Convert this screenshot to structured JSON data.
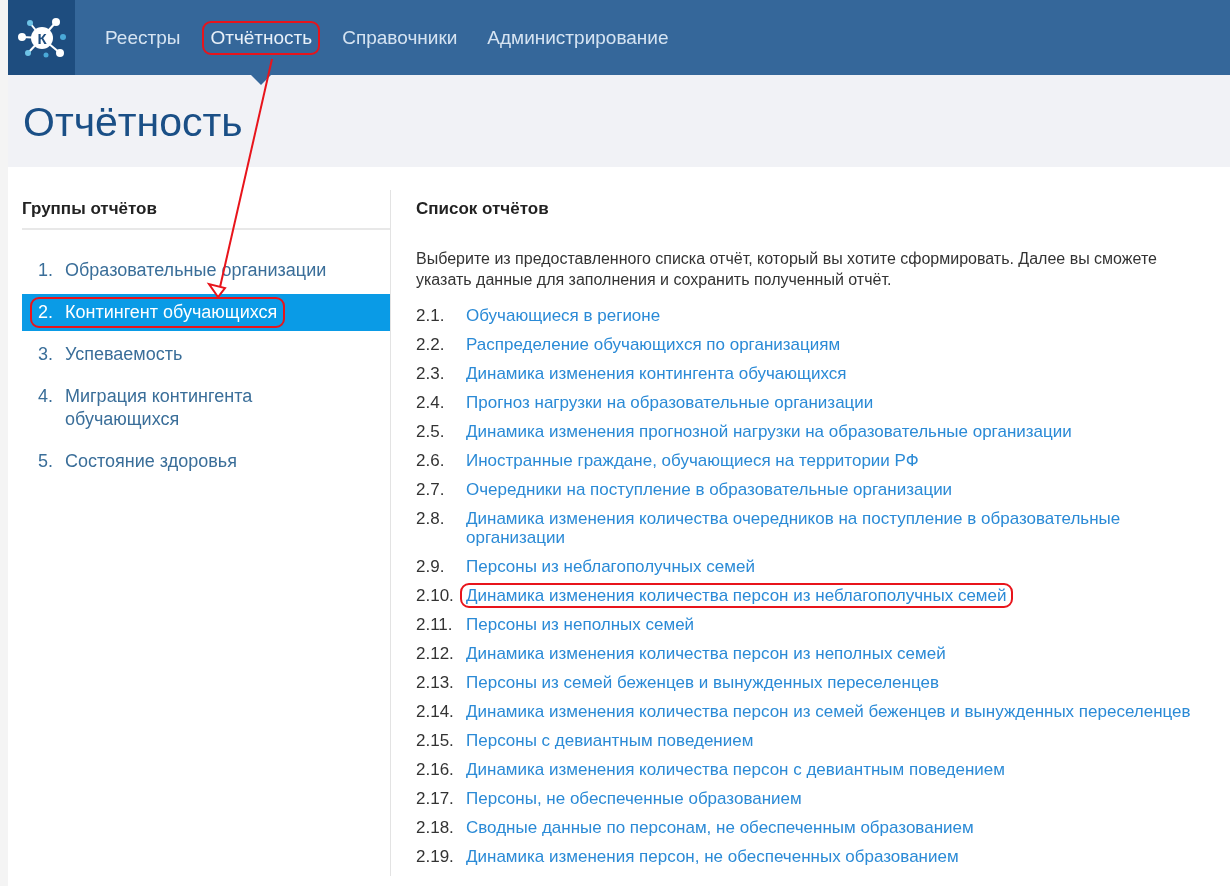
{
  "logo_letter": "К",
  "nav": [
    {
      "label": "Реестры",
      "selected": false,
      "highlighted": false
    },
    {
      "label": "Отчётность",
      "selected": true,
      "highlighted": true
    },
    {
      "label": "Справочники",
      "selected": false,
      "highlighted": false
    },
    {
      "label": "Администрирование",
      "selected": false,
      "highlighted": false
    }
  ],
  "page_title": "Отчётность",
  "groups": {
    "heading": "Группы отчётов",
    "items": [
      {
        "number": "1.",
        "label": "Образовательные организации",
        "selected": false,
        "highlighted": false
      },
      {
        "number": "2.",
        "label": "Контингент обучающихся",
        "selected": true,
        "highlighted": true
      },
      {
        "number": "3.",
        "label": "Успеваемость",
        "selected": false,
        "highlighted": false
      },
      {
        "number": "4.",
        "label": "Миграция контингента обучающихся",
        "selected": false,
        "highlighted": false
      },
      {
        "number": "5.",
        "label": "Состояние здоровья",
        "selected": false,
        "highlighted": false
      }
    ]
  },
  "reports": {
    "heading": "Список отчётов",
    "description": "Выберите из предоставленного списка отчёт, который вы хотите сформировать. Далее вы сможете\nуказать данные для заполнения и сохранить полученный отчёт.",
    "items": [
      {
        "number": "2.1.",
        "label": "Обучающиеся в регионе",
        "highlighted": false
      },
      {
        "number": "2.2.",
        "label": "Распределение обучающихся по организациям",
        "highlighted": false
      },
      {
        "number": "2.3.",
        "label": "Динамика изменения контингента обучающихся",
        "highlighted": false
      },
      {
        "number": "2.4.",
        "label": "Прогноз нагрузки на образовательные организации",
        "highlighted": false
      },
      {
        "number": "2.5.",
        "label": "Динамика изменения прогнозной нагрузки на образовательные организации",
        "highlighted": false
      },
      {
        "number": "2.6.",
        "label": "Иностранные граждане, обучающиеся на территории РФ",
        "highlighted": false
      },
      {
        "number": "2.7.",
        "label": "Очередники на поступление в образовательные организации",
        "highlighted": false
      },
      {
        "number": "2.8.",
        "label": "Динамика изменения количества очередников на поступление в образовательные организации",
        "highlighted": false
      },
      {
        "number": "2.9.",
        "label": "Персоны из неблагополучных семей",
        "highlighted": false
      },
      {
        "number": "2.10.",
        "label": "Динамика изменения количества персон из неблагополучных семей",
        "highlighted": true
      },
      {
        "number": "2.11.",
        "label": "Персоны из неполных семей",
        "highlighted": false
      },
      {
        "number": "2.12.",
        "label": "Динамика изменения количества персон из неполных семей",
        "highlighted": false
      },
      {
        "number": "2.13.",
        "label": "Персоны из семей беженцев и вынужденных переселенцев",
        "highlighted": false
      },
      {
        "number": "2.14.",
        "label": "Динамика изменения количества персон из семей беженцев и вынужденных переселенцев",
        "highlighted": false
      },
      {
        "number": "2.15.",
        "label": "Персоны с девиантным поведением",
        "highlighted": false
      },
      {
        "number": "2.16.",
        "label": "Динамика изменения количества персон с девиантным поведением",
        "highlighted": false
      },
      {
        "number": "2.17.",
        "label": "Персоны, не обеспеченные образованием",
        "highlighted": false
      },
      {
        "number": "2.18.",
        "label": "Сводные данные по персонам, не обеспеченным образованием",
        "highlighted": false
      },
      {
        "number": "2.19.",
        "label": "Динамика изменения персон, не обеспеченных образованием",
        "highlighted": false
      }
    ]
  }
}
